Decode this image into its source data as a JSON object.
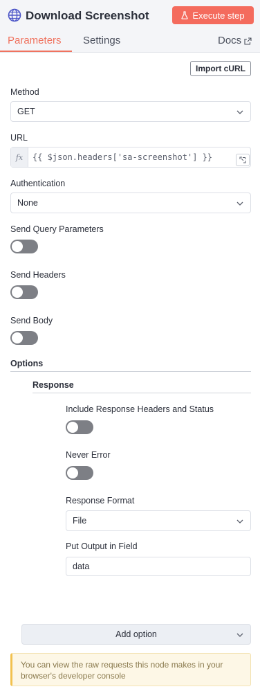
{
  "header": {
    "title": "Download Screenshot",
    "execute_label": "Execute step",
    "node_icon": "globe-icon"
  },
  "tabs": [
    {
      "label": "Parameters",
      "active": true
    },
    {
      "label": "Settings",
      "active": false
    },
    {
      "label": "Docs",
      "active": false,
      "icon": "external-link-icon"
    }
  ],
  "toolbar": {
    "import_curl": "Import cURL"
  },
  "fields": {
    "method": {
      "label": "Method",
      "value": "GET"
    },
    "url": {
      "label": "URL",
      "value": "{{ $json.headers['sa-screenshot'] }}",
      "fx": "fx"
    },
    "authentication": {
      "label": "Authentication",
      "value": "None"
    },
    "send_query": {
      "label": "Send Query Parameters",
      "enabled": false
    },
    "send_headers": {
      "label": "Send Headers",
      "enabled": false
    },
    "send_body": {
      "label": "Send Body",
      "enabled": false
    }
  },
  "options": {
    "title": "Options",
    "response": {
      "title": "Response",
      "include_headers": {
        "label": "Include Response Headers and Status",
        "enabled": false
      },
      "never_error": {
        "label": "Never Error",
        "enabled": false
      },
      "response_format": {
        "label": "Response Format",
        "value": "File"
      },
      "output_field": {
        "label": "Put Output in Field",
        "value": "data"
      }
    },
    "add_option": "Add option"
  },
  "notice": "You can view the raw requests this node makes in your browser's developer console",
  "colors": {
    "accent": "#f46b5d",
    "tab_active": "#f0735f",
    "toggle_off": "#7d7f85",
    "notice_bg": "#fdf7e6"
  }
}
